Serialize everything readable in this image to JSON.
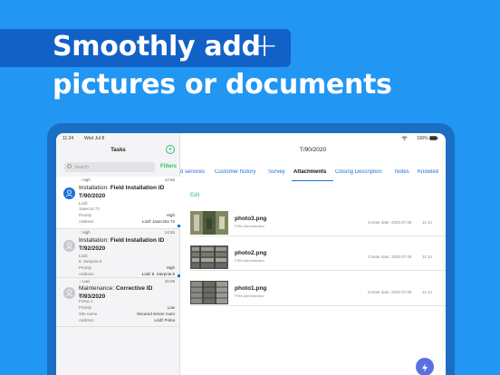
{
  "headline": {
    "line1": "Smoothly add",
    "plus": "+",
    "line2": "pictures or documents"
  },
  "statusbar": {
    "time": "11:24",
    "date": "Wed Jul 8",
    "battery": "100%"
  },
  "sidebar": {
    "title": "Tasks",
    "search_placeholder": "Search",
    "filters_label": "Filters",
    "tasks": [
      {
        "priority": "High",
        "time": "12:55",
        "title_prefix": "Installation: ",
        "title": "Field Installation ID T/90/2020",
        "city": "Łódź",
        "street": "Jasecza 72",
        "kv": [
          {
            "k": "Priority",
            "v": "High"
          },
          {
            "k": "Address",
            "v": "Łódź Jaseczka 72"
          }
        ]
      },
      {
        "priority": "High",
        "time": "14:55",
        "title_prefix": "Installation: ",
        "title": "Field Installation ID T/92/2020",
        "city": "Łódź",
        "street": "8. Sierpnia 8",
        "kv": [
          {
            "k": "Priority",
            "v": "High"
          },
          {
            "k": "Address",
            "v": "Łódź 8. Sierpnia 8"
          }
        ]
      },
      {
        "priority": "Low",
        "time": "15:05",
        "title_prefix": "Maintenance: ",
        "title": "Corrective ID T/93/2020",
        "city": "Łódź",
        "street": "Polna 1",
        "kv": [
          {
            "k": "Priority",
            "v": "Low"
          },
          {
            "k": "Site name",
            "v": "Secured server room"
          },
          {
            "k": "Address",
            "v": "Łódź Polna"
          }
        ]
      }
    ]
  },
  "main": {
    "title": "T/90/2020",
    "tabs": [
      "d services",
      "Customer history",
      "Survey",
      "Attachments",
      "Closing Description",
      "Notes",
      "Knowled"
    ],
    "active_tab": "Attachments",
    "edit_label": "Edit",
    "attachments": [
      {
        "name": "photo3.png",
        "role": "FSM Administrator",
        "date": "Create date: 2020.07.08",
        "time": "11:14"
      },
      {
        "name": "photo2.png",
        "role": "FSM Administrator",
        "date": "Create date: 2020.07.08",
        "time": "11:14"
      },
      {
        "name": "photo1.png",
        "role": "FSM Administrator",
        "date": "Create date: 2020.07.08",
        "time": "11:14"
      }
    ]
  },
  "colors": {
    "background": "#2196f3",
    "accent_green": "#2ec26b",
    "accent_blue": "#1e6fd9",
    "band": "#1261c7"
  }
}
